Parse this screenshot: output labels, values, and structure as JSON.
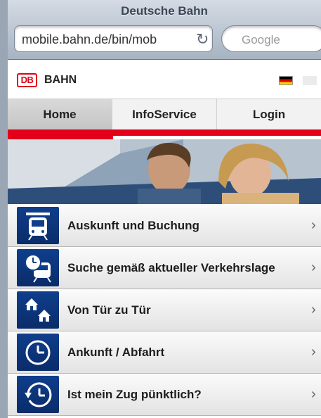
{
  "browser": {
    "title": "Deutsche Bahn",
    "url": "mobile.bahn.de/bin/mob",
    "search_placeholder": "Google"
  },
  "header": {
    "logo_text": "DB",
    "brand": "BAHN"
  },
  "nav": {
    "tabs": [
      {
        "label": "Home",
        "active": true
      },
      {
        "label": "InfoService",
        "active": false
      },
      {
        "label": "Login",
        "active": false
      }
    ]
  },
  "colors": {
    "brand_red": "#e2001a",
    "icon_blue": "#0f3e8c"
  },
  "menu": {
    "items": [
      {
        "label": "Auskunft und Buchung",
        "icon": "train-icon"
      },
      {
        "label": "Suche gemäß aktueller Verkehrslage",
        "icon": "train-clock-icon"
      },
      {
        "label": "Von Tür zu Tür",
        "icon": "house-to-house-icon"
      },
      {
        "label": "Ankunft / Abfahrt",
        "icon": "clock-icon"
      },
      {
        "label": "Ist mein Zug pünktlich?",
        "icon": "clock-refresh-icon"
      }
    ]
  }
}
